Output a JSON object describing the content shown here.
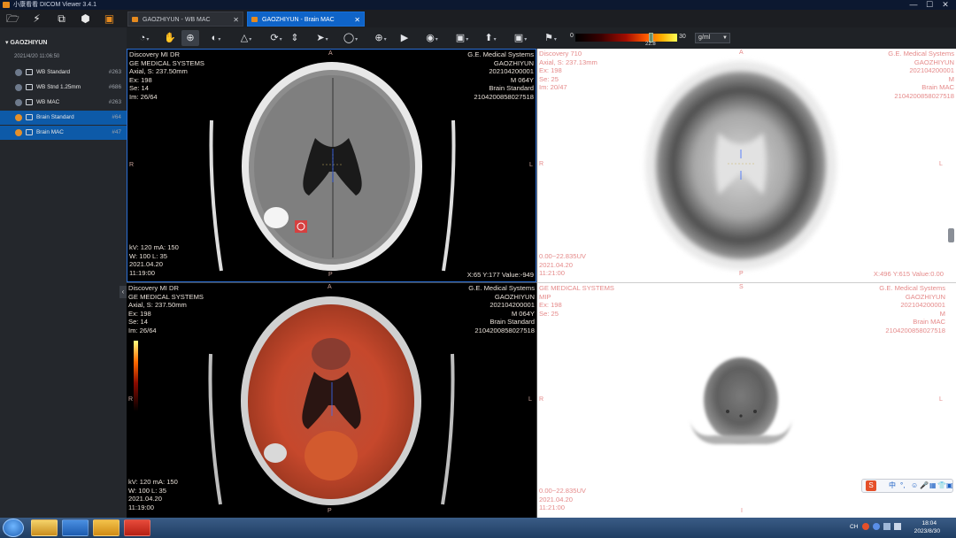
{
  "window": {
    "title": "小康看看 DICOM Viewer 3.4.1",
    "min": "—",
    "max": "☐",
    "close": "✕"
  },
  "tabs": [
    {
      "label": "GAOZHIYUN - WB MAC",
      "close": "✕"
    },
    {
      "label": "GAOZHIYUN - Brain MAC",
      "close": "✕"
    }
  ],
  "sidebar": {
    "patient": "GAOZHIYUN",
    "study_date": "2021/4/20 11:06:50",
    "series": [
      {
        "name": "WB Standard",
        "count": "#263",
        "selected": false,
        "checked": false
      },
      {
        "name": "WB Stnd 1.25mm",
        "count": "#686",
        "selected": false,
        "checked": false
      },
      {
        "name": "WB MAC",
        "count": "#263",
        "selected": false,
        "checked": false
      },
      {
        "name": "Brain Standard",
        "count": "#64",
        "selected": true,
        "checked": true
      },
      {
        "name": "Brain MAC",
        "count": "#47",
        "selected": true,
        "checked": true
      }
    ],
    "collapse": "‹"
  },
  "colorbar": {
    "min": "0",
    "max": "30",
    "value": "22.8",
    "unit": "g/ml",
    "palette": [
      "#000000",
      "#3a0000",
      "#a40d00",
      "#ff5a00",
      "#ffae00",
      "#ffff55"
    ]
  },
  "viewports": {
    "ct": {
      "tl": [
        "Discovery MI DR",
        "GE MEDICAL SYSTEMS",
        "Axial, S: 237.50mm",
        "Ex: 198",
        "Se: 14",
        "Im: 26/64"
      ],
      "tr": [
        "G.E. Medical Systems",
        "GAOZHIYUN",
        "202104200001",
        "M 064Y",
        "Brain Standard",
        "2104200858027518"
      ],
      "bl": [
        "kV: 120 mA: 150",
        "W: 100 L: 35",
        "2021.04.20",
        "11:19:00"
      ],
      "br": "X:65 Y:177 Value:-949",
      "top": "A",
      "bottom": "P",
      "left": "R",
      "right": "L"
    },
    "pet": {
      "tl": [
        "Discovery 710",
        "Axial, S: 237.13mm",
        "Ex: 198",
        "Se: 25",
        "Im: 20/47"
      ],
      "tr": [
        "G.E. Medical Systems",
        "GAOZHIYUN",
        "202104200001",
        "M",
        "Brain MAC",
        "2104200858027518"
      ],
      "bl": [
        "0.00~22.835UV",
        "2021.04.20",
        "11:21:00"
      ],
      "br": "X:496 Y:615 Value:0.00",
      "top": "A",
      "bottom": "P",
      "left": "R",
      "right": "L"
    },
    "fusion": {
      "tl": [
        "Discovery MI DR",
        "GE MEDICAL SYSTEMS",
        "Axial, S: 237.50mm",
        "Ex: 198",
        "Se: 14",
        "Im: 26/64"
      ],
      "tr": [
        "G.E. Medical Systems",
        "GAOZHIYUN",
        "202104200001",
        "M 064Y",
        "Brain Standard",
        "2104200858027518"
      ],
      "bl": [
        "kV: 120 mA: 150",
        "W: 100 L: 35",
        "2021.04.20",
        "11:19:00"
      ],
      "top": "A",
      "bottom": "P",
      "left": "R",
      "right": "L"
    },
    "mip": {
      "tl": [
        "GE MEDICAL SYSTEMS",
        "MIP",
        "Ex: 198",
        "Se: 25"
      ],
      "tr": [
        "G.E. Medical Systems",
        "GAOZHIYUN",
        "202104200001",
        "M",
        "Brain MAC",
        "2104200858027518"
      ],
      "bl": [
        "0.00~22.835UV",
        "2021.04.20",
        "11:21:00"
      ],
      "top": "S",
      "bottom": "I",
      "left": "R",
      "right": "L"
    }
  },
  "ime": {
    "s": "S",
    "items": [
      "中",
      "°,",
      "☺",
      "🎤",
      "▦",
      "👕",
      "▣"
    ]
  },
  "taskbar": {
    "time": "18:04",
    "date": "2023/8/30",
    "tray": "CH"
  }
}
